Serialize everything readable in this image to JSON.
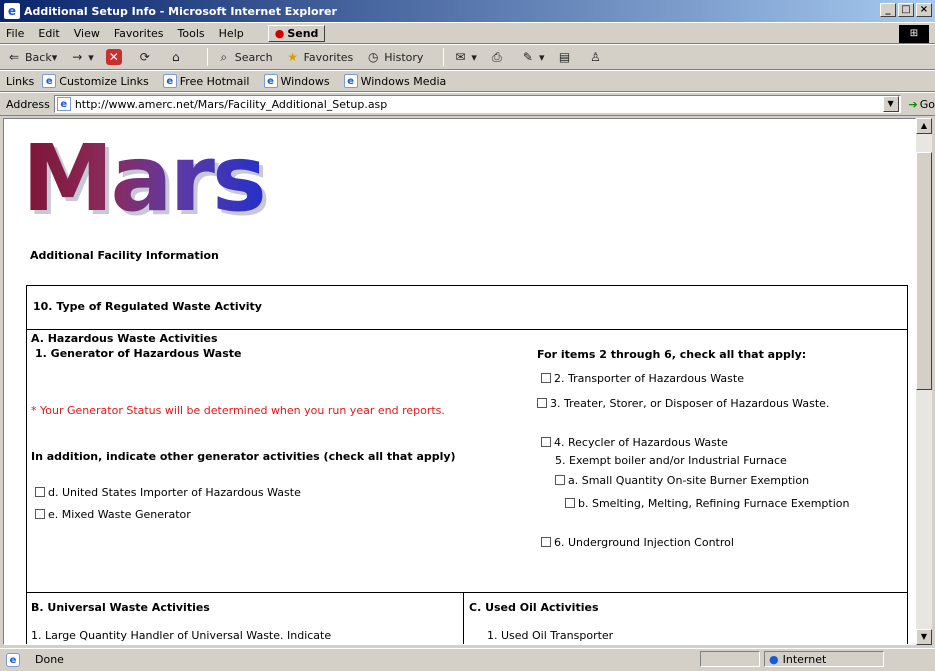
{
  "window": {
    "title": "Additional Setup Info - Microsoft Internet Explorer"
  },
  "menu": {
    "items": [
      "File",
      "Edit",
      "View",
      "Favorites",
      "Tools",
      "Help"
    ],
    "send_label": "Send"
  },
  "toolbar": {
    "back": "Back",
    "search": "Search",
    "favorites": "Favorites",
    "history": "History"
  },
  "links": {
    "label": "Links",
    "items": [
      "Customize Links",
      "Free Hotmail",
      "Windows",
      "Windows Media"
    ]
  },
  "address": {
    "label": "Address",
    "url": "http://www.amerc.net/Mars/Facility_Additional_Setup.asp",
    "go": "Go"
  },
  "page": {
    "logo": "Mars",
    "subtitle": "Additional Facility Information",
    "section10": "10. Type of Regulated Waste Activity",
    "a_title": "A. Hazardous Waste Activities",
    "a_item1": "1. Generator of Hazardous Waste",
    "a_note": "* Your Generator Status will be determined when you run year end reports.",
    "a_in_addition": "In addition, indicate other generator activities (check all that apply)",
    "a_d": "d. United States Importer of Hazardous Waste",
    "a_e": "e. Mixed Waste Generator",
    "right_header": "For items 2 through 6, check all that apply:",
    "r2": "2. Transporter of Hazardous Waste",
    "r3": "3. Treater, Storer, or Disposer of Hazardous Waste.",
    "r4": "4. Recycler of Hazardous Waste",
    "r5": "5. Exempt boiler and/or Industrial Furnace",
    "r5a": "a. Small Quantity On-site Burner Exemption",
    "r5b": "b. Smelting, Melting, Refining Furnace Exemption",
    "r6": "6. Underground Injection Control",
    "b_title": "B. Universal Waste Activities",
    "b_item1": "1. Large Quantity Handler of Universal Waste. Indicate",
    "c_title": "C. Used Oil Activities",
    "c_item1": "1. Used Oil Transporter"
  },
  "status": {
    "left": "Done",
    "zone": "Internet"
  }
}
